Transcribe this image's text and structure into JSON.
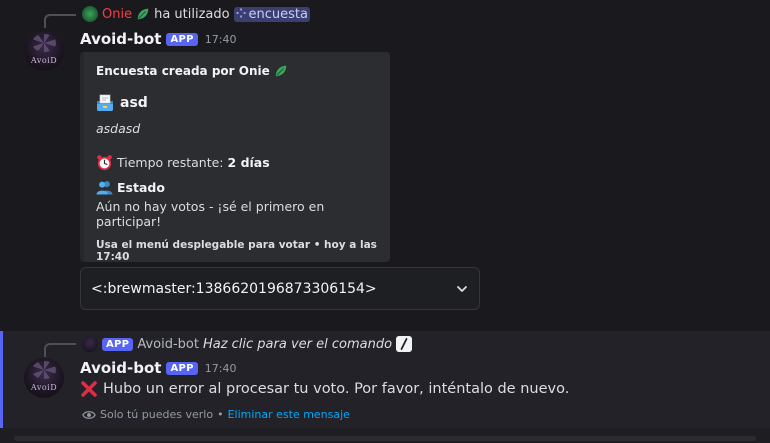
{
  "message1": {
    "reply": {
      "user": "Onie",
      "used_text": "ha utilizado",
      "command": "encuesta",
      "user_color": "#f23f43",
      "leaf_color": "#3ba55c"
    },
    "author": {
      "avatar_text": "AvoiD",
      "name": "Avoid-bot",
      "badge": "APP",
      "time": "17:40"
    },
    "embed": {
      "author": "Encuesta creada por Onie",
      "title": "asd",
      "description": "asdasd",
      "time_label": "Tiempo restante:",
      "time_value": "2 días",
      "status_name": "Estado",
      "status_value": "Aún no hay votos - ¡sé el primero en participar!",
      "footer": "Usa el menú desplegable para votar • hoy a las 17:40"
    },
    "select": {
      "value": "<:brewmaster:1386620196873306154>"
    }
  },
  "message2": {
    "reply": {
      "badge": "APP",
      "user": "Avoid-bot",
      "hint": "Haz clic para ver el comando"
    },
    "author": {
      "avatar_text": "AvoiD",
      "name": "Avoid-bot",
      "badge": "APP",
      "time": "17:40"
    },
    "error_text": "Hubo un error al procesar tu voto. Por favor, inténtalo de nuevo.",
    "ephemeral": {
      "only_you": "Solo tú puedes verlo",
      "separator": "•",
      "delete_link": "Eliminar este mensaje"
    }
  },
  "colors": {
    "accent": "#5865f2",
    "link": "#00a8fc",
    "error_red": "#dd2e44"
  },
  "icons": [
    "leaf-icon",
    "ballot-box-icon",
    "alarm-clock-icon",
    "people-icon",
    "chevron-down-icon",
    "cross-mark-icon",
    "eye-icon",
    "slash-command-icon"
  ]
}
